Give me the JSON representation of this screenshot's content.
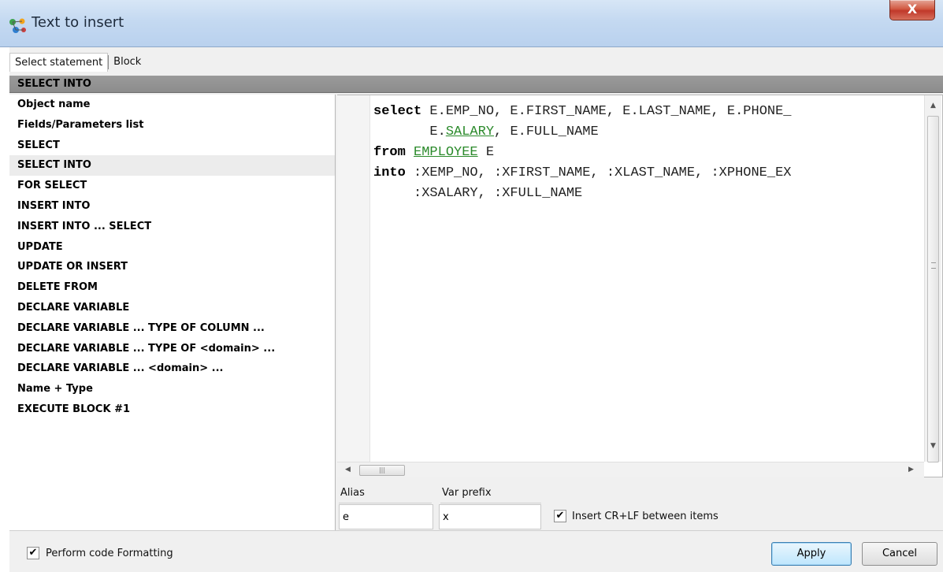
{
  "window": {
    "title": "Text to insert",
    "close_glyph": "X"
  },
  "tabs": [
    {
      "label": "Select statement",
      "active": true
    },
    {
      "label": "Block",
      "active": false
    }
  ],
  "section_header": "SELECT INTO",
  "list": {
    "selected_index": 3,
    "items": [
      "Object name",
      "Fields/Parameters list",
      "SELECT",
      "SELECT INTO",
      "FOR SELECT",
      "INSERT INTO",
      "INSERT INTO ... SELECT",
      "UPDATE",
      "UPDATE OR INSERT",
      "DELETE FROM",
      "DECLARE VARIABLE",
      "DECLARE VARIABLE ... TYPE OF COLUMN ...",
      "DECLARE VARIABLE ... TYPE OF <domain> ...",
      "DECLARE VARIABLE ... <domain> ...",
      "Name + Type",
      "EXECUTE BLOCK #1"
    ]
  },
  "code": {
    "line1_kw": "select",
    "line1_rest": " E.EMP_NO, E.FIRST_NAME, E.LAST_NAME, E.PHONE_",
    "line2_pre": "       E.",
    "line2_field": "SALARY",
    "line2_rest": ", E.FULL_NAME",
    "line3_kw": "from",
    "line3_table": "EMPLOYEE",
    "line3_rest": " E",
    "line4_kw": "into",
    "line4_rest": " :XEMP_NO, :XFIRST_NAME, :XLAST_NAME, :XPHONE_EX",
    "line5": "     :XSALARY, :XFULL_NAME"
  },
  "fields": {
    "alias_label": "Alias",
    "alias_value": "e",
    "var_prefix_label": "Var prefix",
    "var_prefix_value": "x",
    "insert_crlf_label": "Insert CR+LF between items",
    "insert_crlf_checked": true
  },
  "footer": {
    "format_label": "Perform code Formatting",
    "format_checked": true,
    "apply_label": "Apply",
    "cancel_label": "Cancel"
  },
  "icons": {
    "app": "code-insert-icon",
    "close": "close-icon",
    "scroll_up": "arrow-up-icon",
    "scroll_down": "arrow-down-icon",
    "scroll_left": "arrow-left-icon",
    "scroll_right": "arrow-right-icon",
    "check": "checkmark-icon"
  },
  "colors": {
    "table_highlight": "#2b8a2b",
    "header_bg": "#8c8c8c",
    "default_button": "#bee6fd"
  }
}
